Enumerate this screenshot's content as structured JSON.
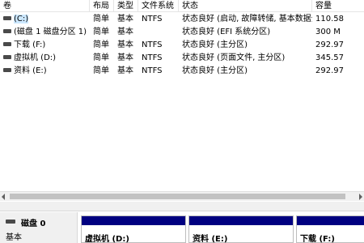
{
  "columns": {
    "name": "卷",
    "layout": "布局",
    "type": "类型",
    "fs": "文件系统",
    "status": "状态",
    "capacity": "容量"
  },
  "volumes": [
    {
      "name": "(C:)",
      "layout": "简单",
      "type": "基本",
      "fs": "NTFS",
      "status": "状态良好 (启动, 故障转储, 基本数据分区)",
      "capacity": "110.58"
    },
    {
      "name": "(磁盘 1 磁盘分区 1)",
      "layout": "简单",
      "type": "基本",
      "fs": "",
      "status": "状态良好 (EFI 系统分区)",
      "capacity": "300 M"
    },
    {
      "name": "下载 (F:)",
      "layout": "简单",
      "type": "基本",
      "fs": "NTFS",
      "status": "状态良好 (主分区)",
      "capacity": "292.97"
    },
    {
      "name": "虚拟机 (D:)",
      "layout": "简单",
      "type": "基本",
      "fs": "NTFS",
      "status": "状态良好 (页面文件, 主分区)",
      "capacity": "345.57"
    },
    {
      "name": "资料 (E:)",
      "layout": "简单",
      "type": "基本",
      "fs": "NTFS",
      "status": "状态良好 (主分区)",
      "capacity": "292.97"
    }
  ],
  "disk": {
    "name": "磁盘 0",
    "type": "基本"
  },
  "partitions": [
    {
      "label": "虚拟机 (D:)"
    },
    {
      "label": "资料 (E:)"
    },
    {
      "label": "下载 (F:)"
    }
  ],
  "colors": {
    "partition_bar": "#000080",
    "selection": "#cce8ff"
  }
}
